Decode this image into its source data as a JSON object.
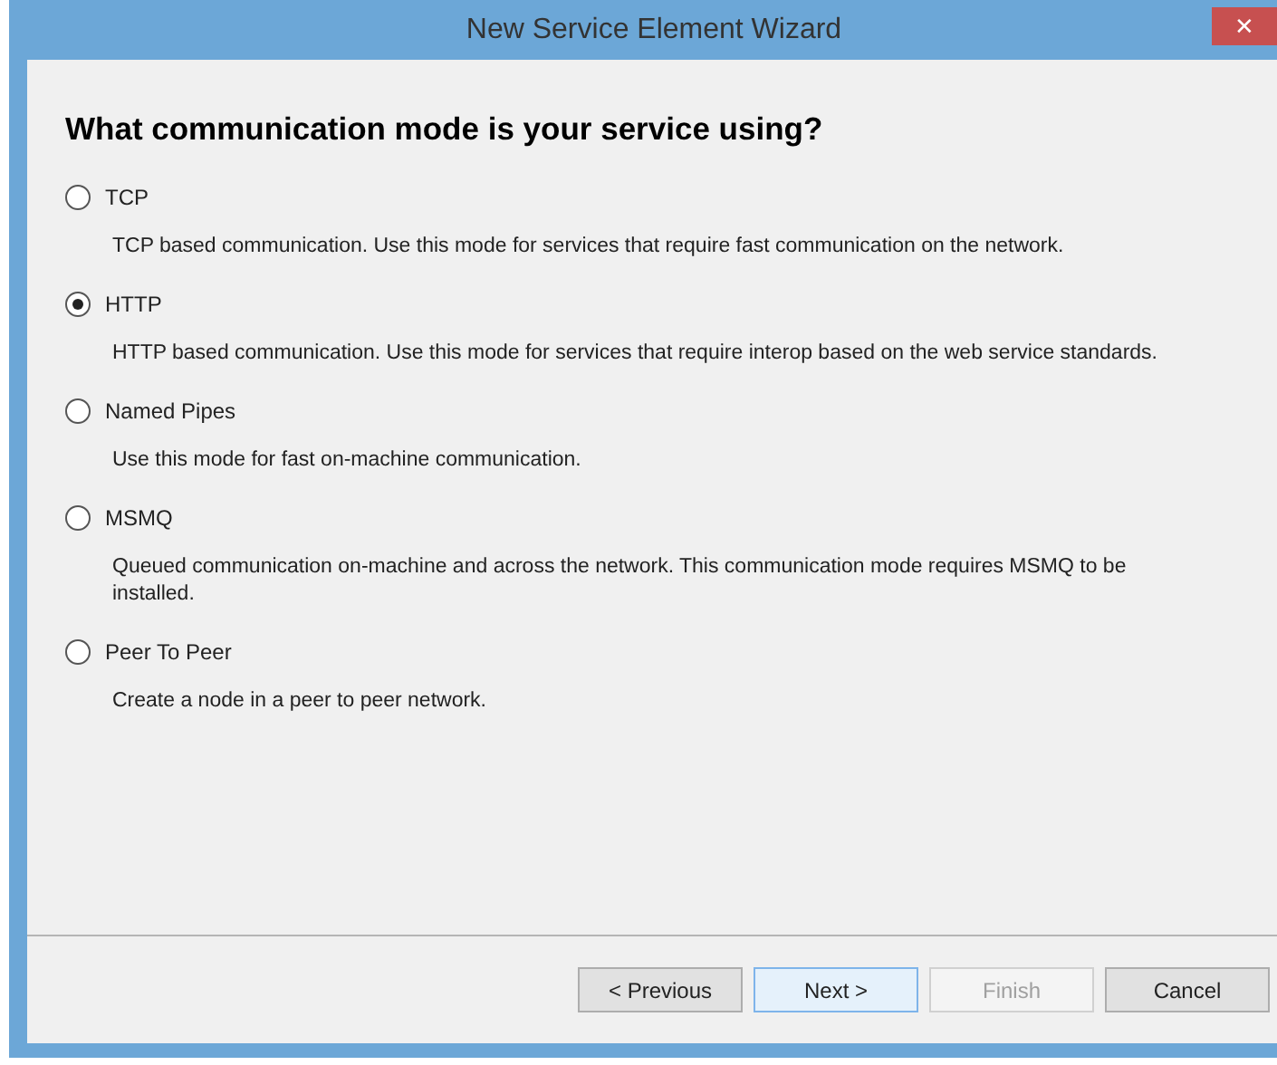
{
  "window": {
    "title": "New Service Element Wizard",
    "close": "✕"
  },
  "heading": "What communication mode is your service using?",
  "options": [
    {
      "label": "TCP",
      "description": "TCP based communication. Use this mode for services that require fast communication on the network.",
      "selected": false
    },
    {
      "label": "HTTP",
      "description": "HTTP based communication. Use this mode for services that require interop based on the web service standards.",
      "selected": true
    },
    {
      "label": "Named Pipes",
      "description": "Use this mode for fast on-machine communication.",
      "selected": false
    },
    {
      "label": "MSMQ",
      "description": "Queued communication on-machine and across the network. This communication mode requires MSMQ to be installed.",
      "selected": false
    },
    {
      "label": "Peer To Peer",
      "description": "Create a node in a peer to peer network.",
      "selected": false
    }
  ],
  "buttons": [
    {
      "label": "< Previous",
      "disabled": false,
      "focused": false
    },
    {
      "label": "Next >",
      "disabled": false,
      "focused": true
    },
    {
      "label": "Finish",
      "disabled": true,
      "focused": false
    },
    {
      "label": "Cancel",
      "disabled": false,
      "focused": false
    }
  ]
}
